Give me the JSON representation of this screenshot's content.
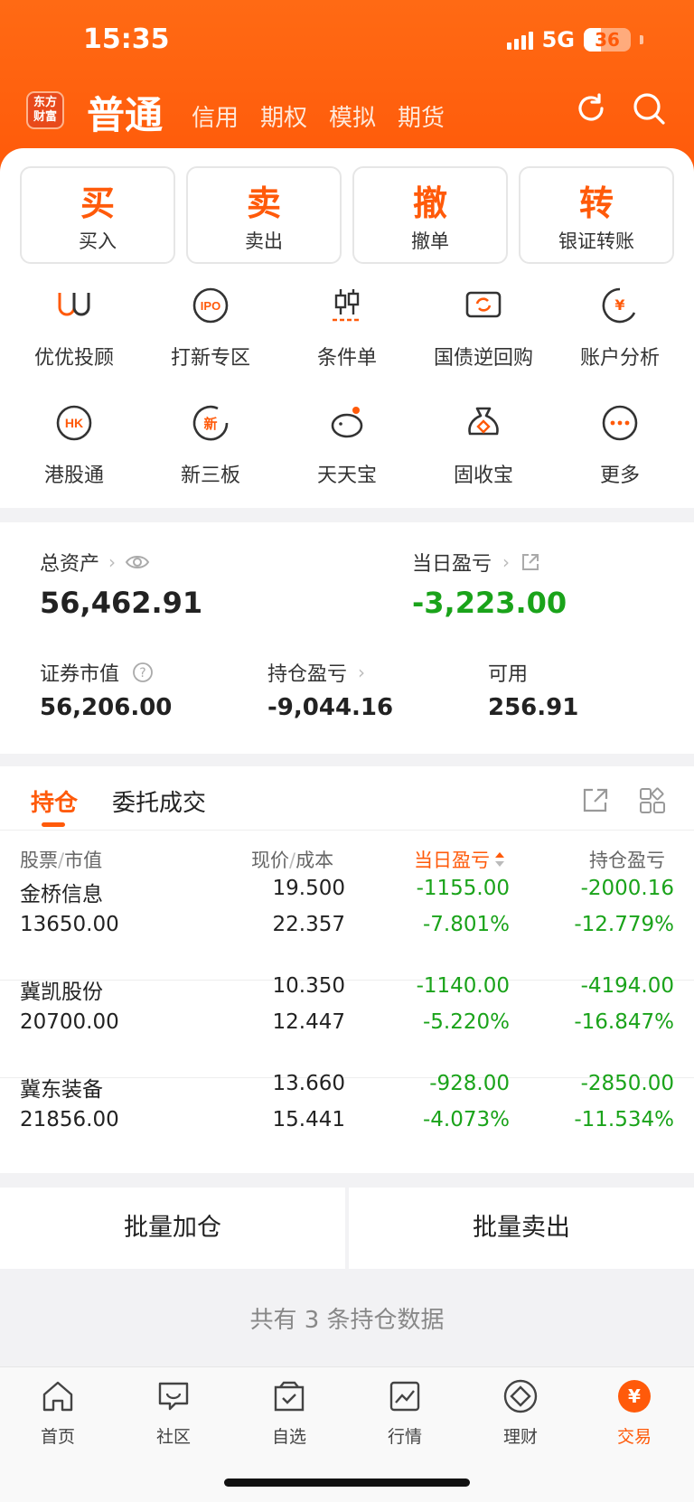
{
  "status_bar": {
    "time": "15:35",
    "network": "5G",
    "battery": "36"
  },
  "header": {
    "logo_text": "东方财富",
    "active_tab": "普通",
    "tabs": [
      "信用",
      "期权",
      "模拟",
      "期货"
    ]
  },
  "quick_actions": [
    {
      "big": "买",
      "small": "买入"
    },
    {
      "big": "卖",
      "small": "卖出"
    },
    {
      "big": "撤",
      "small": "撤单"
    },
    {
      "big": "转",
      "small": "银证转账"
    }
  ],
  "services": [
    {
      "label": "优优投顾",
      "icon": "advisor-icon"
    },
    {
      "label": "打新专区",
      "icon": "ipo-icon",
      "icon_text": "IPO"
    },
    {
      "label": "条件单",
      "icon": "candlestick-icon"
    },
    {
      "label": "国债逆回购",
      "icon": "repo-icon"
    },
    {
      "label": "账户分析",
      "icon": "account-analysis-icon"
    },
    {
      "label": "港股通",
      "icon": "hk-icon",
      "icon_text": "HK"
    },
    {
      "label": "新三板",
      "icon": "new-third-board-icon",
      "icon_text": "新"
    },
    {
      "label": "天天宝",
      "icon": "piggy-bank-icon"
    },
    {
      "label": "固收宝",
      "icon": "money-bag-icon"
    },
    {
      "label": "更多",
      "icon": "more-icon"
    }
  ],
  "assets": {
    "total_label": "总资产",
    "total_value": "56,462.91",
    "daily_pl_label": "当日盈亏",
    "daily_pl_value": "-3,223.00",
    "market_value_label": "证券市值",
    "market_value": "56,206.00",
    "position_pl_label": "持仓盈亏",
    "position_pl_value": "-9,044.16",
    "available_label": "可用",
    "available_value": "256.91"
  },
  "holdings": {
    "tab_active": "持仓",
    "tab_other": "委托成交",
    "columns": {
      "stock": "股票",
      "market_value": "市值",
      "price": "现价",
      "cost": "成本",
      "daily_pl": "当日盈亏",
      "position_pl": "持仓盈亏"
    },
    "rows": [
      {
        "name": "金桥信息",
        "market_value": "13650.00",
        "price": "19.500",
        "cost": "22.357",
        "daily_pl": "-1155.00",
        "daily_pct": "-7.801%",
        "pos_pl": "-2000.16",
        "pos_pct": "-12.779%"
      },
      {
        "name": "冀凯股份",
        "market_value": "20700.00",
        "price": "10.350",
        "cost": "12.447",
        "daily_pl": "-1140.00",
        "daily_pct": "-5.220%",
        "pos_pl": "-4194.00",
        "pos_pct": "-16.847%"
      },
      {
        "name": "冀东装备",
        "market_value": "21856.00",
        "price": "13.660",
        "cost": "15.441",
        "daily_pl": "-928.00",
        "daily_pct": "-4.073%",
        "pos_pl": "-2850.00",
        "pos_pct": "-11.534%"
      }
    ]
  },
  "batch": {
    "add": "批量加仓",
    "sell": "批量卖出"
  },
  "footer_note": "共有 3 条持仓数据",
  "bottom_nav": [
    {
      "label": "首页",
      "icon": "home-icon"
    },
    {
      "label": "社区",
      "icon": "community-icon"
    },
    {
      "label": "自选",
      "icon": "watchlist-icon"
    },
    {
      "label": "行情",
      "icon": "market-icon"
    },
    {
      "label": "理财",
      "icon": "wealth-icon"
    },
    {
      "label": "交易",
      "icon": "trade-icon",
      "icon_text": "¥"
    }
  ],
  "colors": {
    "brand": "#ff5a0a",
    "loss_green": "#1aa31a"
  }
}
